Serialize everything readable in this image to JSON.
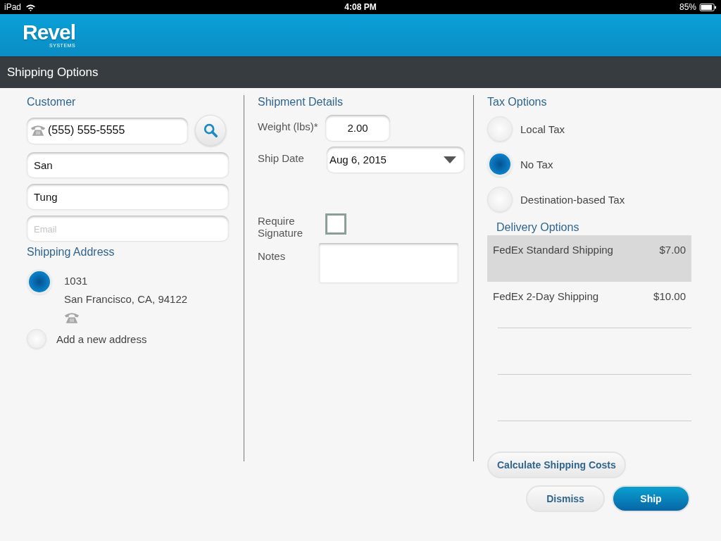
{
  "status_bar": {
    "device": "iPad",
    "time": "4:08 PM",
    "battery": "85%"
  },
  "header": {
    "logo": "Revel",
    "logo_sub": "SYSTEMS"
  },
  "title": "Shipping Options",
  "customer": {
    "heading": "Customer",
    "phone": "(555) 555-5555",
    "first_name": "San",
    "last_name": "Tung",
    "email_placeholder": "Email"
  },
  "shipping_address": {
    "heading": "Shipping Address",
    "options": [
      {
        "kind": "address",
        "selected": true,
        "lines": [
          "1031",
          "San Francisco, CA, 94122"
        ]
      },
      {
        "kind": "new",
        "selected": false,
        "label": "Add a new address"
      }
    ]
  },
  "shipment": {
    "heading": "Shipment Details",
    "weight_label": "Weight (lbs)*",
    "weight": "2.00",
    "date_label": "Ship Date",
    "date": "Aug 6, 2015",
    "signature_label": "Require Signature",
    "signature_checked": false,
    "notes_label": "Notes"
  },
  "tax": {
    "heading": "Tax Options",
    "options": [
      {
        "label": "Local Tax",
        "selected": false
      },
      {
        "label": "No Tax",
        "selected": true
      },
      {
        "label": "Destination-based Tax",
        "selected": false
      }
    ]
  },
  "delivery": {
    "heading": "Delivery Options",
    "options": [
      {
        "name": "FedEx Standard Shipping",
        "price": "$7.00",
        "selected": true
      },
      {
        "name": "FedEx 2-Day Shipping",
        "price": "$10.00",
        "selected": false
      }
    ]
  },
  "buttons": {
    "calculate": "Calculate Shipping Costs",
    "dismiss": "Dismiss",
    "ship": "Ship"
  }
}
